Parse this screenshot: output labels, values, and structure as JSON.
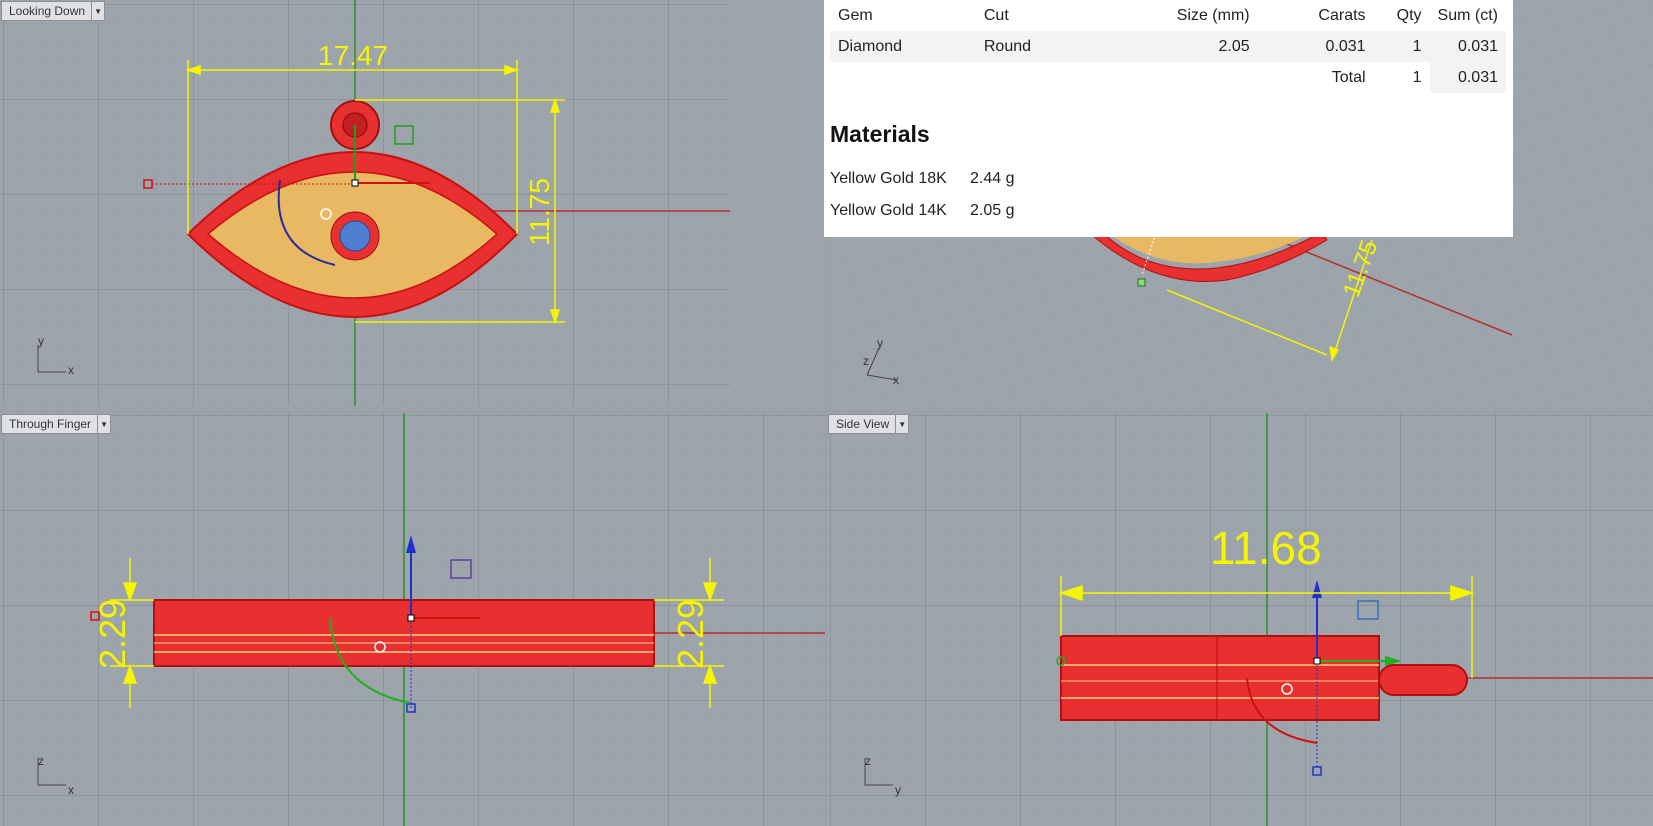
{
  "viewports": {
    "top_left": {
      "label": "Looking Down",
      "dims": {
        "width": "17.47",
        "height": "11.75"
      },
      "axes": {
        "a": "y",
        "b": "x"
      }
    },
    "top_right": {
      "dims": {
        "height": "11.75"
      },
      "axes": {
        "a": "y",
        "b": "x",
        "c": "z"
      }
    },
    "bottom_left": {
      "label": "Through Finger",
      "dims": {
        "left": "2.29",
        "right": "2.29"
      },
      "axes": {
        "a": "z",
        "b": "x"
      }
    },
    "bottom_right": {
      "label": "Side View",
      "dims": {
        "width": "11.68"
      },
      "axes": {
        "a": "z",
        "b": "y"
      }
    }
  },
  "gem_report": {
    "headers": {
      "gem": "Gem",
      "cut": "Cut",
      "size": "Size (mm)",
      "carats": "Carats",
      "qty": "Qty",
      "sum": "Sum (ct)"
    },
    "rows": [
      {
        "gem": "Diamond",
        "cut": "Round",
        "size": "2.05",
        "carats": "0.031",
        "qty": "1",
        "sum": "0.031"
      }
    ],
    "total": {
      "label": "Total",
      "qty": "1",
      "sum": "0.031"
    }
  },
  "materials": {
    "title": "Materials",
    "items": [
      {
        "name": "Yellow Gold 18K",
        "weight": "2.44 g"
      },
      {
        "name": "Yellow Gold 14K",
        "weight": "2.05 g"
      }
    ]
  },
  "colors": {
    "viewport_bg": "#9da4ab",
    "dimension": "#f5f500",
    "selection": "#e02020",
    "gold_fill": "#e8b860",
    "gem_blue": "#4f7fd0"
  },
  "icons": [
    "dropdown-arrow-icon",
    "axis-triad-icon",
    "gumball-icon"
  ]
}
